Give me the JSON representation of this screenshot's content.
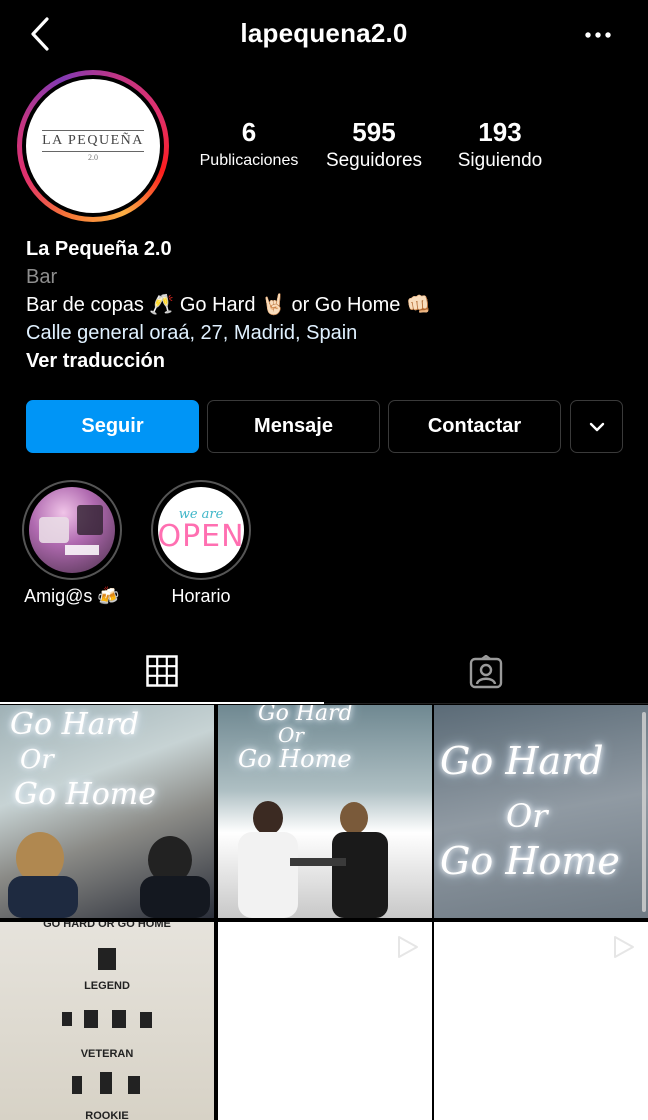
{
  "header": {
    "username": "lapequena2.0",
    "back_icon": "chevron-left-icon",
    "more_icon": "more-horizontal-icon"
  },
  "profile": {
    "avatar_logo_text": "LA PEQUEÑA",
    "avatar_logo_sub": "2.0",
    "stats": {
      "publications_value": "6",
      "publications_label": "Publicaciones",
      "followers_value": "595",
      "followers_label": "Seguidores",
      "following_value": "193",
      "following_label": "Siguiendo"
    }
  },
  "bio": {
    "name": "La Pequeña 2.0",
    "category": "Bar",
    "text": "Bar de copas 🥂 Go Hard 🤘🏻 or Go Home 👊🏻",
    "address": "Calle general oraá, 27, Madrid, Spain",
    "translate": "Ver traducción"
  },
  "actions": {
    "follow": "Seguir",
    "message": "Mensaje",
    "contact": "Contactar",
    "more_icon": "chevron-down-icon"
  },
  "highlights": [
    {
      "label": "Amig@s 🍻"
    },
    {
      "label": "Horario",
      "image_text_top": "we are",
      "image_text_main": "OPEN"
    }
  ],
  "tabs": [
    {
      "name": "posts",
      "icon": "grid-icon",
      "active": true
    },
    {
      "name": "tagged",
      "icon": "tagged-person-icon",
      "active": false
    }
  ],
  "posts": [
    {
      "type": "image",
      "neon_lines": [
        "Go Hard",
        "Or",
        "Go Home"
      ]
    },
    {
      "type": "image",
      "neon_lines": [
        "Go Hard",
        "Or",
        "Go Home"
      ]
    },
    {
      "type": "image",
      "neon_lines": [
        "Go Hard",
        "Or",
        "Go Home"
      ]
    },
    {
      "type": "image",
      "poster_lines": [
        "GO HARD OR GO HOME",
        "LEGEND",
        "VETERAN",
        "ROOKIE"
      ]
    },
    {
      "type": "video"
    },
    {
      "type": "video"
    }
  ],
  "colors": {
    "background": "#000000",
    "follow_button": "#0095f6",
    "secondary_text": "#8e8e8e",
    "link_text": "#e0f1ff"
  }
}
